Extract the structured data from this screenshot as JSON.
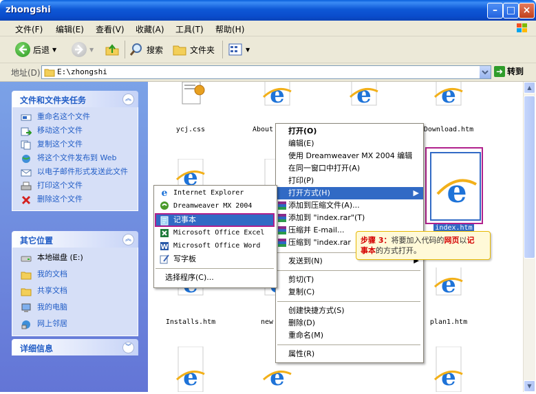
{
  "window": {
    "title": "zhongshi"
  },
  "menubar": [
    "文件(F)",
    "编辑(E)",
    "查看(V)",
    "收藏(A)",
    "工具(T)",
    "帮助(H)"
  ],
  "toolbar": {
    "back": "后退",
    "search": "搜索",
    "folders": "文件夹"
  },
  "address": {
    "label": "地址(D)",
    "value": "E:\\zhongshi",
    "go": "转到"
  },
  "left_panels": {
    "tasks": {
      "title": "文件和文件夹任务",
      "items": [
        "重命名这个文件",
        "移动这个文件",
        "复制这个文件",
        "将这个文件发布到 Web",
        "以电子邮件形式发送此文件",
        "打印这个文件",
        "删除这个文件"
      ]
    },
    "places": {
      "title": "其它位置",
      "items": [
        "本地磁盘 (E:)",
        "我的文档",
        "共享文档",
        "我的电脑",
        "网上邻居"
      ]
    },
    "details": {
      "title": "详细信息"
    }
  },
  "files": [
    "ycj.css",
    "About",
    "Download.htm",
    "index.htm",
    "Installs.htm",
    "new",
    "plan1.htm"
  ],
  "context_menu": [
    "打开(O)",
    "编辑(E)",
    "使用 Dreamweaver MX 2004 编辑",
    "在同一窗口中打开(A)",
    "打印(P)",
    "打开方式(H)",
    "添加到压缩文件(A)...",
    "添加到 \"index.rar\"(T)",
    "压缩并 E-mail...",
    "压缩到 \"index.rar",
    "发送到(N)",
    "剪切(T)",
    "复制(C)",
    "创建快捷方式(S)",
    "删除(D)",
    "重命名(M)",
    "属性(R)"
  ],
  "open_with_menu": [
    "Internet Explorer",
    "Dreamweaver MX 2004",
    "记事本",
    "Microsoft Office Excel",
    "Microsoft Office Word",
    "写字板",
    "选择程序(C)..."
  ],
  "callout": {
    "step": "步骤 3：",
    "text1": "将要加入代码的",
    "web": "网页",
    "text2": "以",
    "notepad1": "记",
    "notepad2": "事本",
    "text3": "的方式打开。"
  },
  "colors": {
    "title_bar": "#0a4ccc",
    "task_pane": "#6f8ee0",
    "selection": "#316ac5",
    "highlight_border": "#b0208c"
  }
}
